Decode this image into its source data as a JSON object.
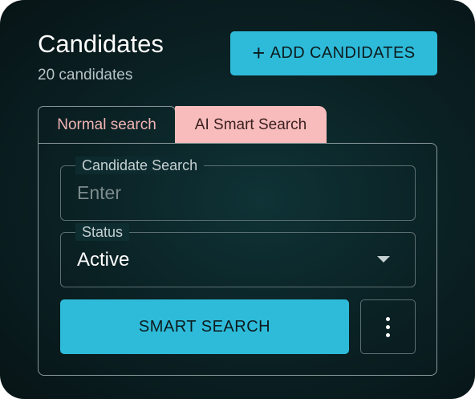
{
  "header": {
    "title": "Candidates",
    "count_label": "20 candidates",
    "add_button_label": "ADD CANDIDATES"
  },
  "tabs": [
    {
      "label": "Normal search",
      "active": false
    },
    {
      "label": "AI Smart Search",
      "active": true
    }
  ],
  "search_field": {
    "label": "Candidate Search",
    "placeholder": "Enter",
    "value": ""
  },
  "status_field": {
    "label": "Status",
    "value": "Active"
  },
  "actions": {
    "smart_search_label": "SMART SEARCH"
  },
  "colors": {
    "accent": "#2ebbd9",
    "active_tab": "#f8bcbc",
    "background": "#0b2326"
  }
}
